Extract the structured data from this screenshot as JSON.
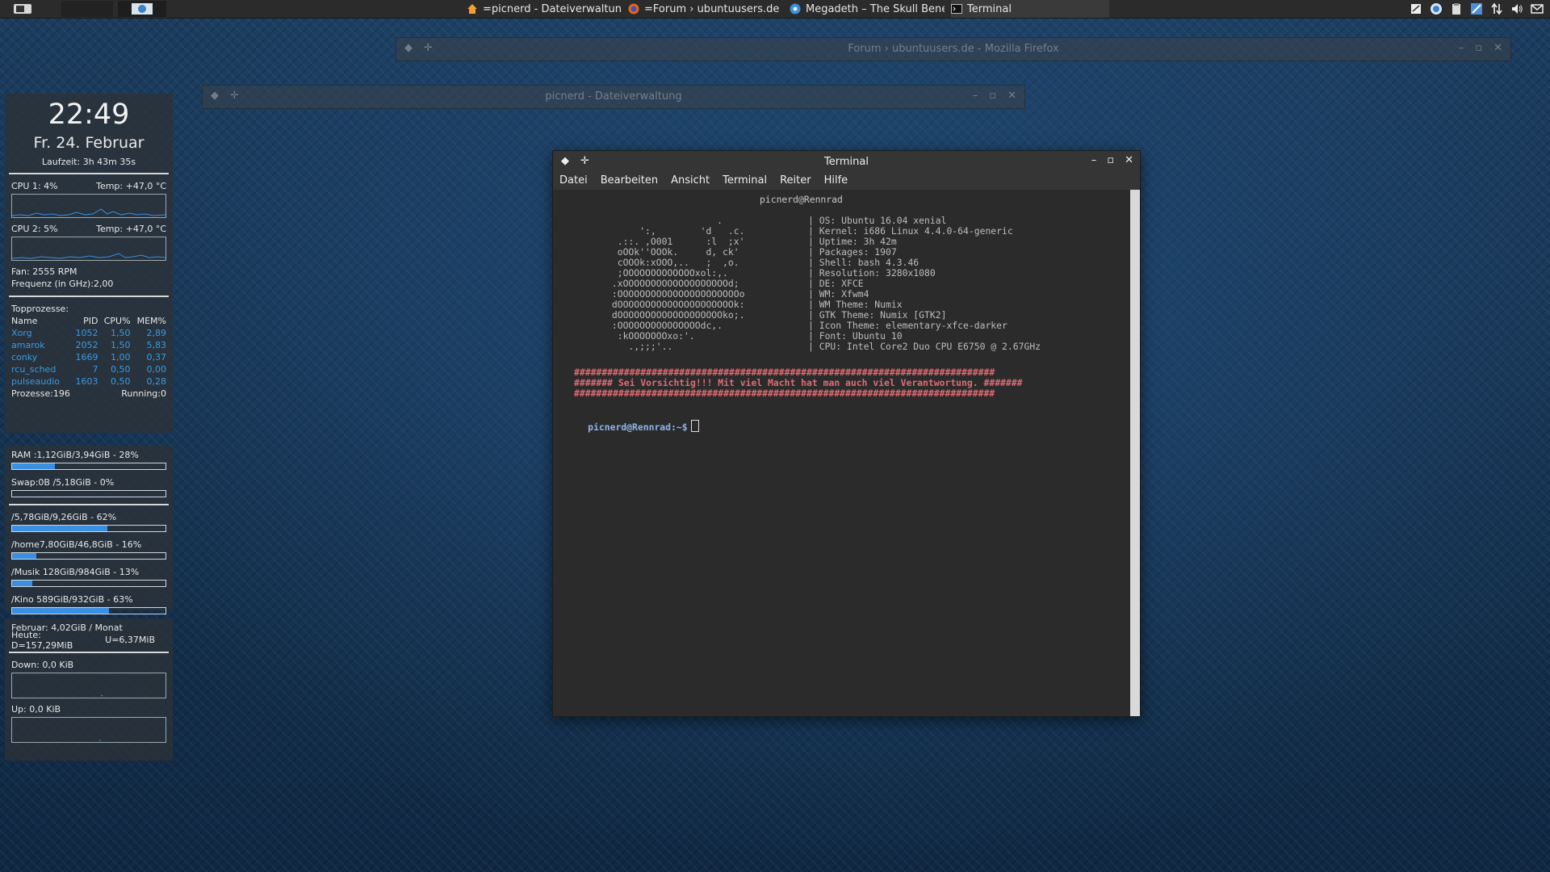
{
  "taskbar": {
    "tasks": [
      {
        "label": "=picnerd - Dateiverwaltung=",
        "icon": "home-folder-icon"
      },
      {
        "label": "=Forum › ubuntuusers.de - ...",
        "icon": "firefox-icon"
      },
      {
        "label": "Megadeth – The Skull Bene...",
        "icon": "music-player-icon"
      },
      {
        "label": "Terminal",
        "icon": "terminal-icon"
      }
    ],
    "tray_icons": [
      "notes-icon",
      "update-icon",
      "clipboard-icon",
      "network-icon",
      "sync-arrows-icon",
      "volume-icon",
      "mail-icon"
    ]
  },
  "bg_windows": {
    "firefox_title": "Forum › ubuntuusers.de - Mozilla Firefox",
    "files_title": "picnerd - Dateiverwaltung"
  },
  "conky": {
    "time": "22:49",
    "date": "Fr. 24. Februar",
    "uptime": "Laufzeit: 3h 43m 35s",
    "cpu1_label": "CPU 1:  4%",
    "cpu1_temp": "Temp: +47,0 °C",
    "cpu2_label": "CPU 2:  5%",
    "cpu2_temp": "Temp: +47,0 °C",
    "fan": "Fan: 2555 RPM",
    "freq": "Frequenz (in GHz):2,00",
    "top_header": "Topprozesse:",
    "cols": [
      "Name",
      "PID",
      "CPU%",
      "MEM%"
    ],
    "processes": [
      {
        "name": "Xorg",
        "pid": "1052",
        "cpu": "1,50",
        "mem": "2,89"
      },
      {
        "name": "amarok",
        "pid": "2052",
        "cpu": "1,50",
        "mem": "5,83"
      },
      {
        "name": "conky",
        "pid": "1669",
        "cpu": "1,00",
        "mem": "0,37"
      },
      {
        "name": "rcu_sched",
        "pid": "7",
        "cpu": "0,50",
        "mem": "0,00"
      },
      {
        "name": "pulseaudio",
        "pid": "1603",
        "cpu": "0,50",
        "mem": "0,28"
      }
    ],
    "proc_count": "Prozesse:196",
    "running": "Running:0",
    "ram": {
      "label": "RAM :1,12GiB/3,94GiB - 28%",
      "fill": 0.28
    },
    "swap": {
      "label": "Swap:0B  /5,18GiB - 0%",
      "fill": 0.0
    },
    "disks": [
      {
        "label": "/5,78GiB/9,26GiB - 62%",
        "fill": 0.62
      },
      {
        "label": "/home7,80GiB/46,8GiB - 16%",
        "fill": 0.16
      },
      {
        "label": "/Musik  128GiB/984GiB - 13%",
        "fill": 0.13
      },
      {
        "label": "/Kino  589GiB/932GiB - 63%",
        "fill": 0.63
      }
    ],
    "net_month": "Februar:  4,02GiB / Monat",
    "net_today_down": "Heute: D=157,29MiB",
    "net_today_up": "U=6,37MiB",
    "down": "Down: 0,0 KiB",
    "up": "Up: 0,0 KiB"
  },
  "terminal": {
    "title": "Terminal",
    "menu": [
      "Datei",
      "Bearbeiten",
      "Ansicht",
      "Terminal",
      "Reiter",
      "Hilfe"
    ],
    "header": "picnerd@Rennrad",
    "ascii": [
      "                    .",
      "      ':,        'd   .c.",
      "  .::. ,O001      :l  ;x'",
      "  oOOk''OOOk.     d, ck'",
      "  cOOOk:xOOO,..   ;  ,o.",
      "  ;OOOOOOOOOOOOOxol:,.",
      " .xOOOOOOOOOOOOOOOOOOOd;",
      " :OOOOOOOOOOOOOOOOOOOOOOo",
      " dOOOOOOOOOOOOOOOOOOOOOk:",
      " dOOOOOOOOOOOOOOOOOOOko;.",
      " :OOOOOOOOOOOOOOOdc,.",
      "  :kOOOOOOOxo:'.",
      "    .,;;;'.."
    ],
    "info": [
      "OS: Ubuntu 16.04 xenial",
      "Kernel: i686 Linux 4.4.0-64-generic",
      "Uptime: 3h 42m",
      "Packages: 1907",
      "Shell: bash 4.3.46",
      "Resolution: 3280x1080",
      "DE: XFCE",
      "WM: Xfwm4",
      "WM Theme: Numix",
      "GTK Theme: Numix [GTK2]",
      "Icon Theme: elementary-xfce-darker",
      "Font: Ubuntu 10",
      "CPU: Intel Core2 Duo CPU E6750 @ 2.67GHz"
    ],
    "hash_line": "############################################################################",
    "warning": "####### Sei Vorsichtig!!! Mit viel Macht hat man auch viel Verantwortung. #######",
    "prompt": "picnerd@Rennrad:~$"
  }
}
